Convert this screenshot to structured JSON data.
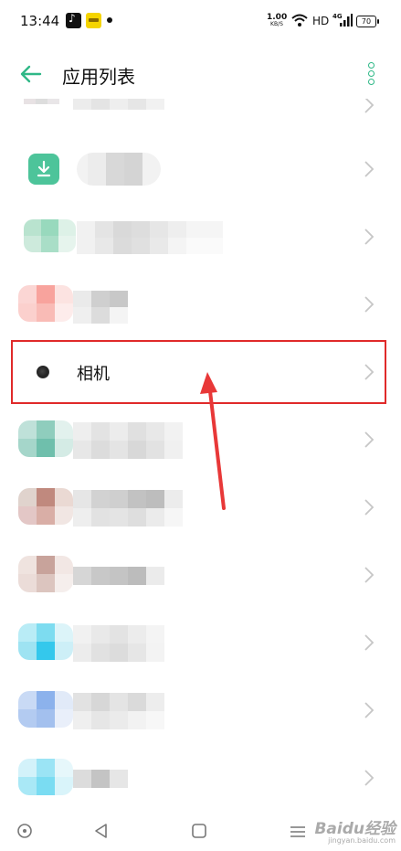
{
  "status_bar": {
    "time": "13:44",
    "net_speed_value": "1.00",
    "net_speed_unit": "KB/S",
    "hd_label": "HD",
    "network_type": "4G",
    "battery_level": "70"
  },
  "header": {
    "title": "应用列表"
  },
  "list": {
    "highlighted_app": "相机"
  },
  "watermark": {
    "brand": "Baidu经验",
    "url": "jingyan.baidu.com"
  },
  "colors": {
    "accent": "#2fb887",
    "highlight_border": "#e02a2a",
    "download_icon": "#4dc49a"
  }
}
